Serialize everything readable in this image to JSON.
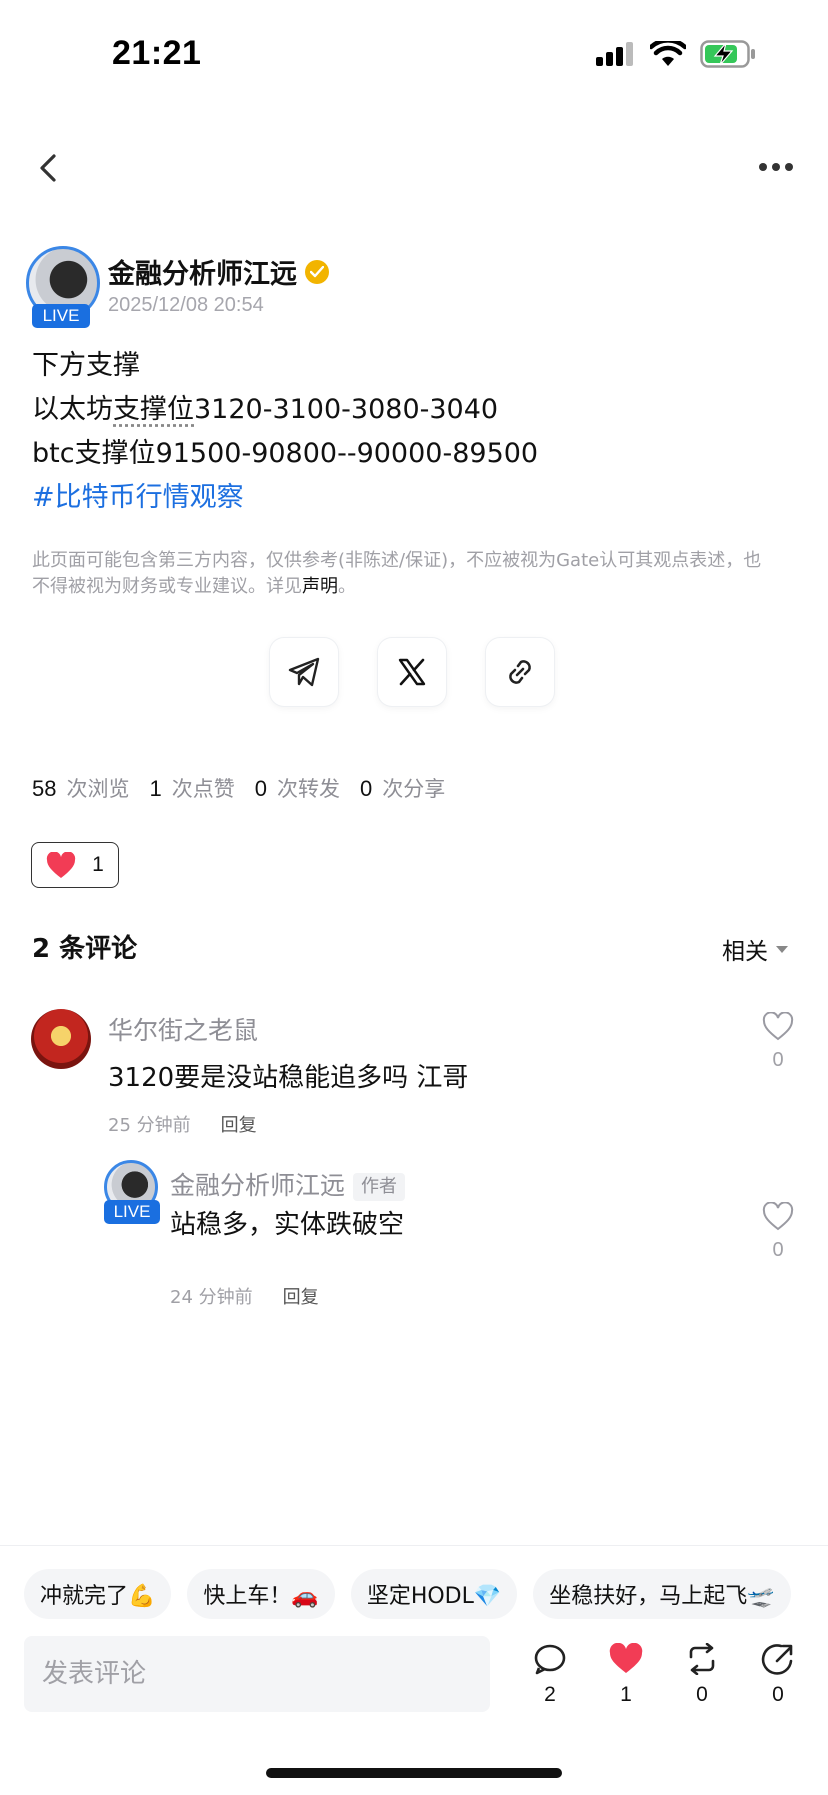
{
  "status_bar": {
    "time": "21:21"
  },
  "author": {
    "name": "金融分析师江远",
    "time": "2025/12/08 20:54",
    "live_label": "LIVE"
  },
  "post": {
    "line1": "下方支撑",
    "line2_prefix": "以太坊",
    "line2_underlined": "支撑位",
    "line2_suffix": "3120-3100-3080-3040",
    "line3": "btc支撑位91500-90800--90000-89500",
    "hashtag": "#比特币行情观察"
  },
  "disclaimer": {
    "text": "此页面可能包含第三方内容，仅供参考(非陈述/保证)，不应被视为Gate认可其观点表述，也不得被视为财务或专业建议。详见",
    "link": "声明",
    "end": "。"
  },
  "stats": {
    "views": "58",
    "views_label": "次浏览",
    "likes": "1",
    "likes_label": "次点赞",
    "reposts": "0",
    "reposts_label": "次转发",
    "shares": "0",
    "shares_label": "次分享"
  },
  "reaction": {
    "count": "1"
  },
  "comments_header": {
    "title": "2 条评论",
    "sort": "相关"
  },
  "comments": [
    {
      "name": "华尔街之老鼠",
      "text": "3120要是没站稳能追多吗 江哥",
      "time": "25 分钟前",
      "reply": "回复",
      "likes": "0"
    },
    {
      "name": "金融分析师江远",
      "tag": "作者",
      "live_label": "LIVE",
      "text": "站稳多，实体跌破空",
      "time": "24 分钟前",
      "reply": "回复",
      "likes": "0"
    }
  ],
  "quick_replies": [
    "冲就完了💪",
    "快上车！🚗",
    "坚定HODL💎",
    "坐稳扶好，马上起飞🛫"
  ],
  "input": {
    "placeholder": "发表评论"
  },
  "bottom_actions": {
    "comments": "2",
    "likes": "1",
    "reposts": "0",
    "shares": "0"
  },
  "colors": {
    "accent": "#1c6fe0",
    "heart": "#f23c55",
    "verified": "#f2b400"
  }
}
